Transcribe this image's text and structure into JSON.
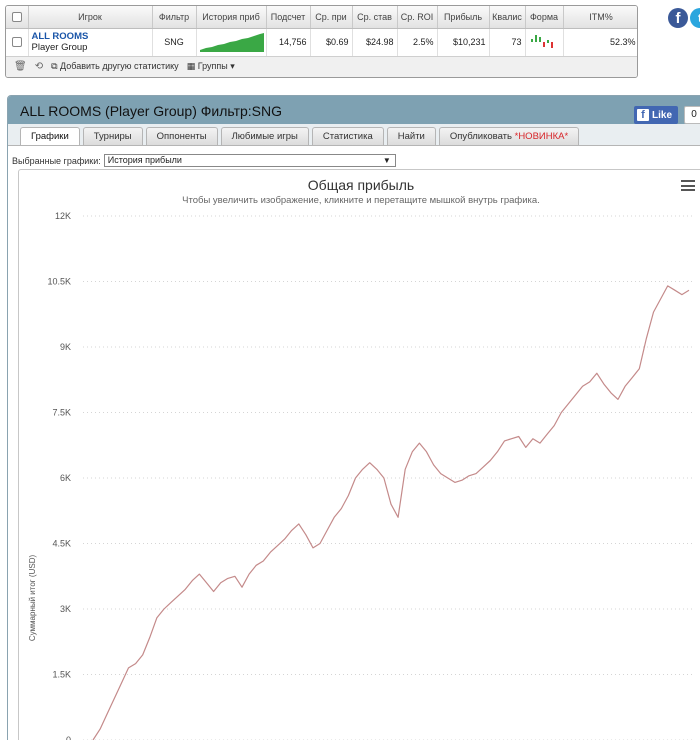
{
  "stats_table": {
    "headers": [
      "Игрок",
      "Фильтр",
      "История приб",
      "Подсчет",
      "Ср. при",
      "Ср. став",
      "Ср. ROI",
      "Прибыль",
      "Квалис",
      "Форма",
      "ITM%"
    ],
    "row": {
      "player_name": "ALL ROOMS",
      "player_group": "Player Group",
      "filter": "SNG",
      "count": "14,756",
      "avg_profit": "$0.69",
      "avg_stake": "$24.98",
      "avg_roi": "2.5%",
      "profit": "$10,231",
      "ability": "73",
      "itm": "52.3%"
    },
    "toolbar": {
      "add_stat_label": "Добавить другую статистику",
      "groups_label": "Группы"
    }
  },
  "social": {
    "facebook_icon": "facebook-icon",
    "twitter_icon": "twitter-icon"
  },
  "panel": {
    "title": "ALL ROOMS (Player Group) Фильтр:SNG",
    "like_label": "Like",
    "like_count": "0",
    "tabs": [
      {
        "label": "Графики"
      },
      {
        "label": "Турниры"
      },
      {
        "label": "Оппоненты"
      },
      {
        "label": "Любимые игры"
      },
      {
        "label": "Статистика"
      },
      {
        "label": "Найти"
      },
      {
        "label": "Опубликовать",
        "badge": "*НОВИНКА*"
      }
    ],
    "selected_chart_label": "Выбранные графики:",
    "selected_chart_value": "История прибыли"
  },
  "colors": {
    "accent_blue": "#1a55a8",
    "header_bar": "#7ea1b2",
    "sparkline_green": "#3aa845",
    "line_color": "#c48a8a",
    "new_badge": "#d8262a"
  },
  "chart_data": {
    "type": "line",
    "title": "Общая прибыль",
    "subtitle": "Чтобы увеличить изображение, кликните и перетащите мышкой внутрь графика.",
    "ylabel": "Суммарный итог (USD)",
    "xlabel": "",
    "ylim": [
      0,
      12000
    ],
    "y_ticks": [
      "0",
      "1.5K",
      "3K",
      "4.5K",
      "6K",
      "7.5K",
      "9K",
      "10.5K",
      "12K"
    ],
    "grid": true,
    "series": [
      {
        "values": [
          0,
          250,
          600,
          950,
          1300,
          1650,
          1750,
          1950,
          2350,
          2800,
          3000,
          3150,
          3300,
          3450,
          3650,
          3800,
          3600,
          3400,
          3600,
          3700,
          3750,
          3500,
          3800,
          4000,
          4100,
          4300,
          4450,
          4600,
          4800,
          4950,
          4700,
          4400,
          4500,
          4800,
          5100,
          5300,
          5600,
          6000,
          6200,
          6350,
          6200,
          6000,
          5400,
          5100,
          6200,
          6600,
          6800,
          6600,
          6300,
          6100,
          6000,
          5900,
          5950,
          6050,
          6100,
          6250,
          6400,
          6600,
          6850,
          6900,
          6950,
          6700,
          6900,
          6800,
          7000,
          7200,
          7500,
          7700,
          7900,
          8100,
          8200,
          8400,
          8150,
          7950,
          7800,
          8100,
          8300,
          8500,
          9200,
          9800,
          10100,
          10400,
          10300,
          10200,
          10300
        ]
      }
    ]
  }
}
